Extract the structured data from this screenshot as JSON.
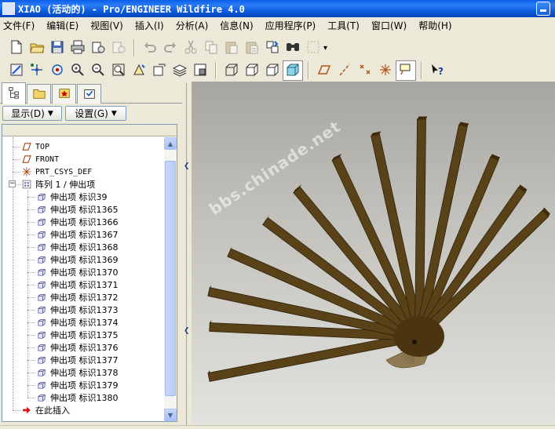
{
  "window": {
    "title": "XIAO (活动的) - Pro/ENGINEER Wildfire 4.0"
  },
  "menu": [
    {
      "label": "文件(F)"
    },
    {
      "label": "编辑(E)"
    },
    {
      "label": "视图(V)"
    },
    {
      "label": "插入(I)"
    },
    {
      "label": "分析(A)"
    },
    {
      "label": "信息(N)"
    },
    {
      "label": "应用程序(P)"
    },
    {
      "label": "工具(T)"
    },
    {
      "label": "窗口(W)"
    },
    {
      "label": "帮助(H)"
    }
  ],
  "toolbar1": [
    {
      "icon": "new-file-icon"
    },
    {
      "icon": "open-folder-icon"
    },
    {
      "icon": "save-icon"
    },
    {
      "icon": "print-icon"
    },
    {
      "icon": "send-mail-icon"
    },
    {
      "icon": "email-link-icon",
      "disabled": true
    },
    {
      "sep": true
    },
    {
      "icon": "undo-icon",
      "disabled": true
    },
    {
      "icon": "redo-icon",
      "disabled": true
    },
    {
      "icon": "cut-icon",
      "disabled": true
    },
    {
      "icon": "copy-icon",
      "disabled": true
    },
    {
      "icon": "paste-icon",
      "disabled": true
    },
    {
      "icon": "paste-special-icon",
      "disabled": true
    },
    {
      "icon": "regenerate-icon"
    },
    {
      "icon": "find-icon"
    },
    {
      "icon": "select-box-icon",
      "disabled": true
    }
  ],
  "toolbar2": [
    {
      "icon": "repaint-icon"
    },
    {
      "icon": "spin-center-icon"
    },
    {
      "icon": "orient-mode-icon"
    },
    {
      "icon": "zoom-in-icon"
    },
    {
      "icon": "zoom-out-icon"
    },
    {
      "icon": "refit-icon"
    },
    {
      "icon": "reorient-icon"
    },
    {
      "icon": "saved-views-icon"
    },
    {
      "icon": "layers-icon"
    },
    {
      "icon": "view-manager-icon"
    },
    {
      "sep": true
    },
    {
      "icon": "wireframe-icon"
    },
    {
      "icon": "hidden-line-icon"
    },
    {
      "icon": "no-hidden-icon"
    },
    {
      "icon": "shading-icon",
      "pressed": true
    },
    {
      "sep": true
    },
    {
      "icon": "datum-planes-icon"
    },
    {
      "icon": "datum-axes-icon"
    },
    {
      "icon": "datum-points-icon"
    },
    {
      "icon": "coordinate-systems-icon"
    },
    {
      "icon": "annotation-display-icon",
      "pressed": true
    },
    {
      "sep": true
    },
    {
      "icon": "context-help-icon"
    }
  ],
  "panel": {
    "tabs": [
      {
        "icon": "model-tree-icon",
        "active": true
      },
      {
        "icon": "folder-browser-icon"
      },
      {
        "icon": "favorites-icon"
      },
      {
        "icon": "connections-icon"
      }
    ],
    "show_label": "显示(D)",
    "settings_label": "设置(G)"
  },
  "tree": {
    "items": [
      {
        "label": "TOP",
        "icon": "datum-plane-icon",
        "mono": true,
        "level": 1
      },
      {
        "label": "FRONT",
        "icon": "datum-plane-icon",
        "mono": true,
        "level": 1
      },
      {
        "label": "PRT_CSYS_DEF",
        "icon": "coordinate-system-icon",
        "mono": true,
        "level": 1
      },
      {
        "label": "阵列 1 / 伸出项",
        "icon": "pattern-icon",
        "level": 1,
        "expanded": true
      },
      {
        "label": "伸出项 标识39",
        "icon": "extrude-feature-icon",
        "level": 2
      },
      {
        "label": "伸出项 标识1365",
        "icon": "extrude-feature-icon",
        "level": 2
      },
      {
        "label": "伸出项 标识1366",
        "icon": "extrude-feature-icon",
        "level": 2
      },
      {
        "label": "伸出项 标识1367",
        "icon": "extrude-feature-icon",
        "level": 2
      },
      {
        "label": "伸出项 标识1368",
        "icon": "extrude-feature-icon",
        "level": 2
      },
      {
        "label": "伸出项 标识1369",
        "icon": "extrude-feature-icon",
        "level": 2
      },
      {
        "label": "伸出项 标识1370",
        "icon": "extrude-feature-icon",
        "level": 2
      },
      {
        "label": "伸出项 标识1371",
        "icon": "extrude-feature-icon",
        "level": 2
      },
      {
        "label": "伸出项 标识1372",
        "icon": "extrude-feature-icon",
        "level": 2
      },
      {
        "label": "伸出项 标识1373",
        "icon": "extrude-feature-icon",
        "level": 2
      },
      {
        "label": "伸出项 标识1374",
        "icon": "extrude-feature-icon",
        "level": 2
      },
      {
        "label": "伸出项 标识1375",
        "icon": "extrude-feature-icon",
        "level": 2
      },
      {
        "label": "伸出项 标识1376",
        "icon": "extrude-feature-icon",
        "level": 2
      },
      {
        "label": "伸出项 标识1377",
        "icon": "extrude-feature-icon",
        "level": 2
      },
      {
        "label": "伸出项 标识1378",
        "icon": "extrude-feature-icon",
        "level": 2
      },
      {
        "label": "伸出项 标识1379",
        "icon": "extrude-feature-icon",
        "level": 2
      },
      {
        "label": "伸出项 标识1380",
        "icon": "extrude-feature-icon",
        "level": 2
      },
      {
        "label": "在此插入",
        "icon": "insert-here-arrow-icon",
        "level": 1
      }
    ]
  },
  "viewport": {
    "watermark": "bbs.chinade.net",
    "model_colors": {
      "rib": "#5a4218",
      "rib_dark": "#3e2c0d",
      "hub": "#4a3510",
      "base": "#8f7a52"
    }
  }
}
